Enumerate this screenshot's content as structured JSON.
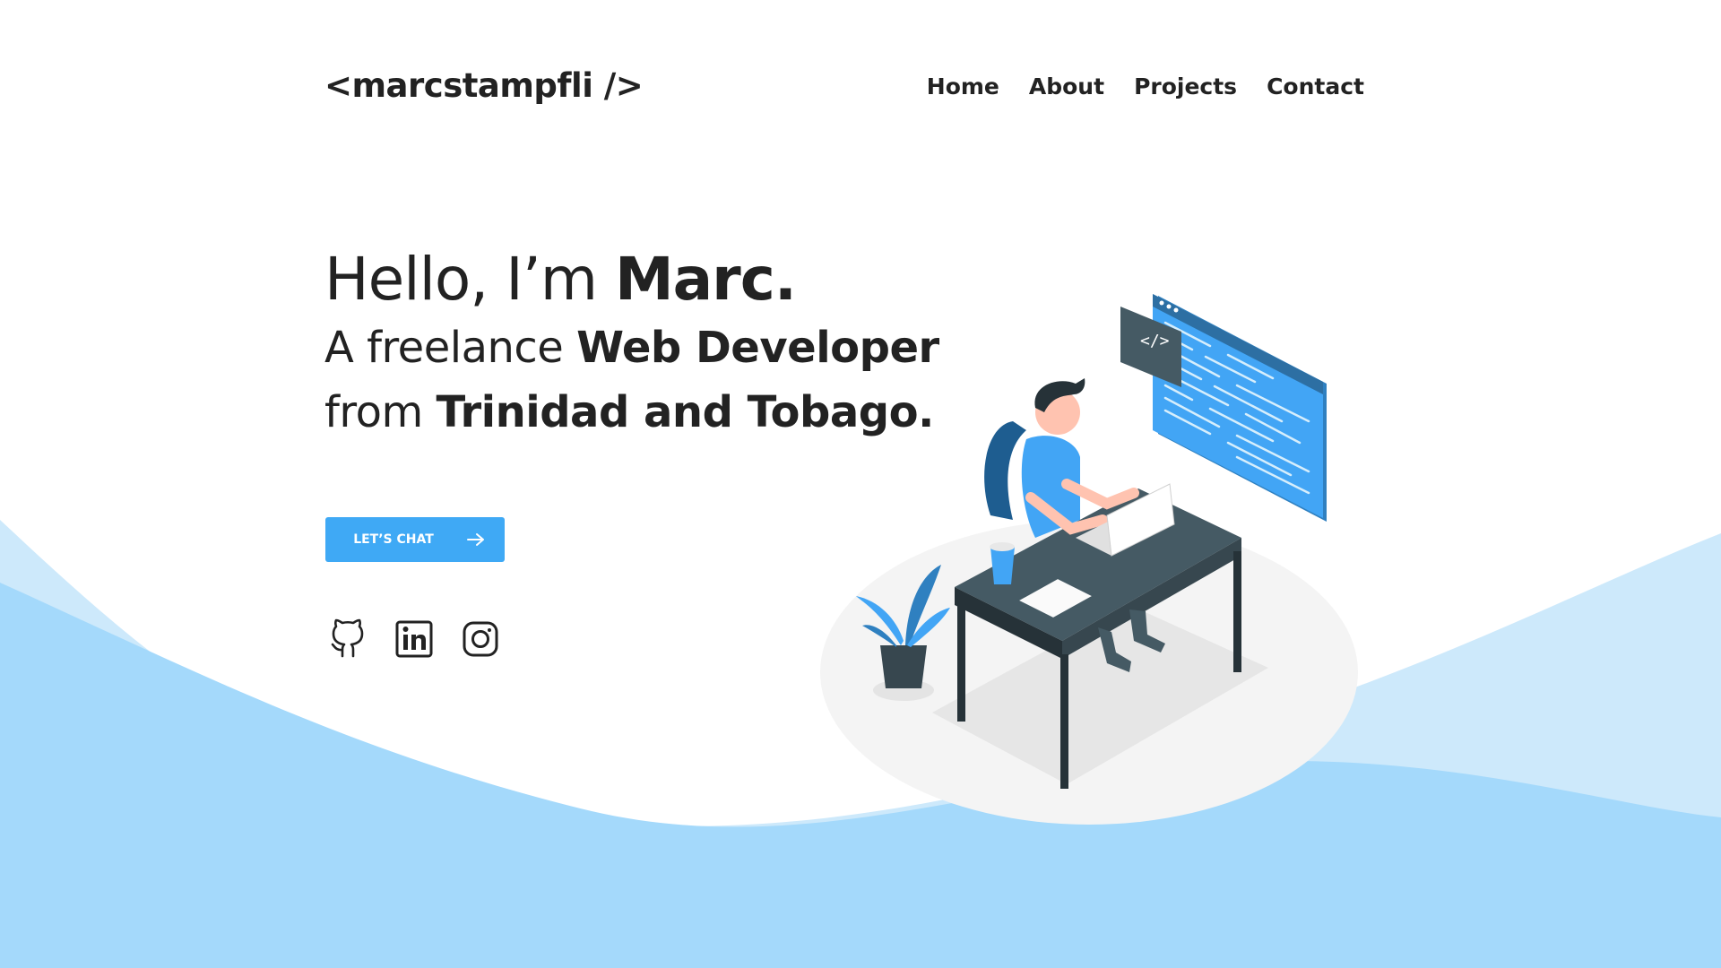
{
  "logo": "<marcstampfli />",
  "nav": {
    "home": "Home",
    "about": "About",
    "projects": "Projects",
    "contact": "Contact"
  },
  "hero": {
    "greeting_light": "Hello, I’m ",
    "greeting_bold": "Marc.",
    "line2_light": "A freelance ",
    "line2_bold": "Web Developer",
    "line3_light": "from ",
    "line3_bold": "Trinidad and Tobago."
  },
  "cta": {
    "label": "LET’S CHAT"
  },
  "socials": [
    "github-icon",
    "linkedin-icon",
    "instagram-icon"
  ],
  "colors": {
    "accent": "#3fa9f5",
    "wave_light": "#cde9fb",
    "wave_dark": "#a4d9fb",
    "text": "#222222",
    "desk": "#37474f"
  }
}
